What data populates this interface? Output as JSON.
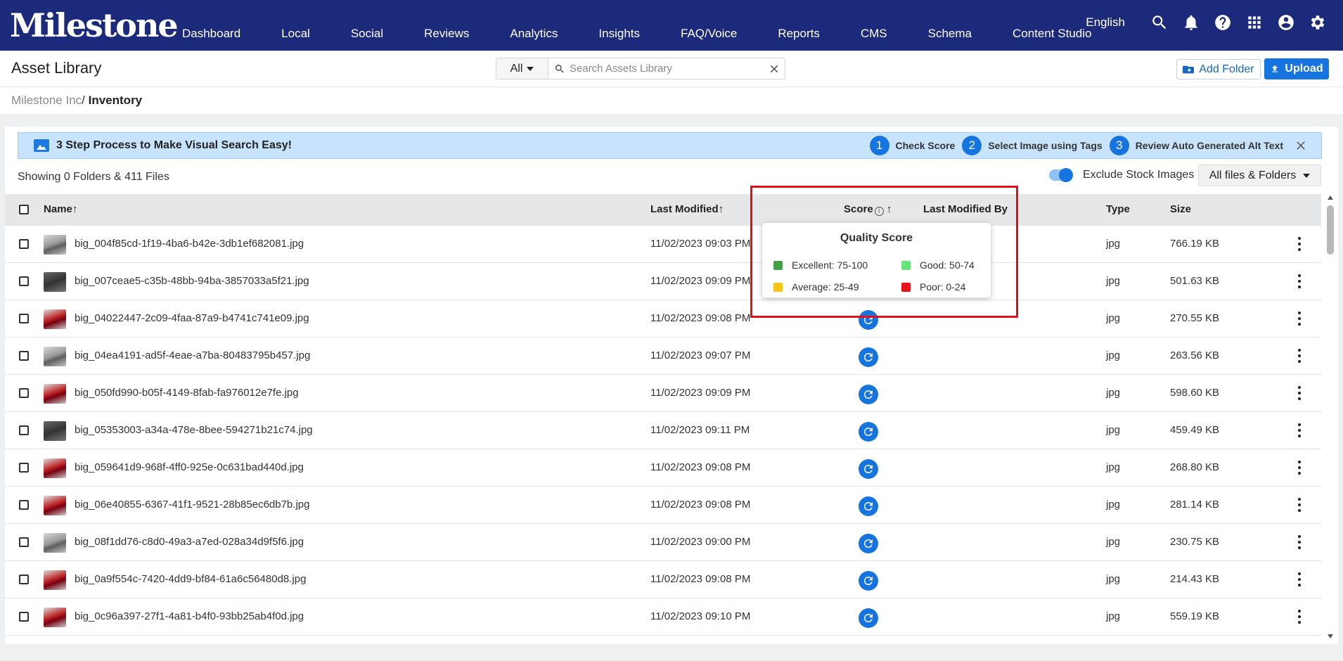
{
  "nav": {
    "logo": "Milestone",
    "items": [
      "Dashboard",
      "Local",
      "Social",
      "Reviews",
      "Analytics",
      "Insights",
      "FAQ/Voice",
      "Reports",
      "CMS",
      "Schema",
      "Content Studio"
    ],
    "language": "English",
    "icons": [
      "search-icon",
      "bell-icon",
      "help-icon",
      "apps-grid-icon",
      "account-icon",
      "gear-icon"
    ]
  },
  "header": {
    "title": "Asset Library",
    "filter_value": "All",
    "search_placeholder": "Search Assets Library",
    "add_folder_label": "Add Folder",
    "upload_label": "Upload"
  },
  "breadcrumb": {
    "root": "Milestone Inc",
    "separator": "/ ",
    "current": "Inventory"
  },
  "banner": {
    "text": "3 Step Process to Make Visual Search Easy!",
    "steps": [
      {
        "num": "1",
        "label": "Check Score"
      },
      {
        "num": "2",
        "label": "Select Image using Tags"
      },
      {
        "num": "3",
        "label": "Review Auto Generated Alt Text"
      }
    ]
  },
  "toolbar": {
    "showing": "Showing 0 Folders & 411 Files",
    "exclude_stock_label": "Exclude Stock Images",
    "exclude_stock_on": true,
    "files_filter": "All files & Folders"
  },
  "table": {
    "headers": {
      "name": "Name",
      "last_modified": "Last Modified",
      "score": "Score",
      "last_modified_by": "Last Modified By",
      "type": "Type",
      "size": "Size"
    },
    "sort_arrow": "↑",
    "rows": [
      {
        "name": "big_004f85cd-1f19-4ba6-b42e-3db1ef682081.jpg",
        "modified": "11/02/2023 09:03 PM",
        "type": "jpg",
        "size": "766.19 KB"
      },
      {
        "name": "big_007ceae5-c35b-48bb-94ba-3857033a5f21.jpg",
        "modified": "11/02/2023 09:09 PM",
        "type": "jpg",
        "size": "501.63 KB"
      },
      {
        "name": "big_04022447-2c09-4faa-87a9-b4741c741e09.jpg",
        "modified": "11/02/2023 09:08 PM",
        "type": "jpg",
        "size": "270.55 KB"
      },
      {
        "name": "big_04ea4191-ad5f-4eae-a7ba-80483795b457.jpg",
        "modified": "11/02/2023 09:07 PM",
        "type": "jpg",
        "size": "263.56 KB"
      },
      {
        "name": "big_050fd990-b05f-4149-8fab-fa976012e7fe.jpg",
        "modified": "11/02/2023 09:09 PM",
        "type": "jpg",
        "size": "598.60 KB"
      },
      {
        "name": "big_05353003-a34a-478e-8bee-594271b21c74.jpg",
        "modified": "11/02/2023 09:11 PM",
        "type": "jpg",
        "size": "459.49 KB"
      },
      {
        "name": "big_059641d9-968f-4ff0-925e-0c631bad440d.jpg",
        "modified": "11/02/2023 09:08 PM",
        "type": "jpg",
        "size": "268.80 KB"
      },
      {
        "name": "big_06e40855-6367-41f1-9521-28b85ec6db7b.jpg",
        "modified": "11/02/2023 09:08 PM",
        "type": "jpg",
        "size": "281.14 KB"
      },
      {
        "name": "big_08f1dd76-c8d0-49a3-a7ed-028a34d9f5f6.jpg",
        "modified": "11/02/2023 09:00 PM",
        "type": "jpg",
        "size": "230.75 KB"
      },
      {
        "name": "big_0a9f554c-7420-4dd9-bf84-61a6c56480d8.jpg",
        "modified": "11/02/2023 09:08 PM",
        "type": "jpg",
        "size": "214.43 KB"
      },
      {
        "name": "big_0c96a397-27f1-4a81-b4f0-93bb25ab4f0d.jpg",
        "modified": "11/02/2023 09:10 PM",
        "type": "jpg",
        "size": "559.19 KB"
      }
    ]
  },
  "quality_popup": {
    "title": "Quality Score",
    "legend": [
      {
        "label": "Excellent: 75-100",
        "color": "#43a047"
      },
      {
        "label": "Good: 50-74",
        "color": "#66e37a"
      },
      {
        "label": "Average: 25-49",
        "color": "#f6c518"
      },
      {
        "label": "Poor: 0-24",
        "color": "#e8131b"
      }
    ]
  },
  "colors": {
    "nav_bg": "#1b2a7a",
    "accent": "#1574e0",
    "highlight": "#e10f18"
  }
}
